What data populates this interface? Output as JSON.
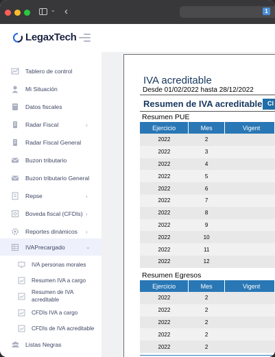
{
  "brand": {
    "name": "LegaxTech"
  },
  "sidebar": {
    "items": [
      {
        "label": "Tablero de control",
        "icon": "chart-icon"
      },
      {
        "label": "Mi Situación",
        "icon": "user-icon"
      },
      {
        "label": "Datos fiscales",
        "icon": "book-icon"
      },
      {
        "label": "Radar Fiscal",
        "icon": "radar-icon",
        "chevron": "›"
      },
      {
        "label": "Radar Fiscal General",
        "icon": "radar-general-icon"
      },
      {
        "label": "Buzon tributario",
        "icon": "mail-icon"
      },
      {
        "label": "Buzon tributario General",
        "icon": "mail-general-icon"
      },
      {
        "label": "Repse",
        "icon": "document-icon",
        "chevron": "›"
      },
      {
        "label": "Boveda fiscal (CFDIs)",
        "icon": "vault-icon",
        "chevron": "›"
      },
      {
        "label": "Reportes dinámicos",
        "icon": "gear-icon",
        "chevron": "›"
      },
      {
        "label": "IVAPrecargado",
        "icon": "table-icon",
        "chevron": "⌄"
      }
    ],
    "sub_items": [
      {
        "label": "IVA personas morales"
      },
      {
        "label": "Resumen IVA a cargo"
      },
      {
        "label": "Resumen de IVA acreditable"
      },
      {
        "label": "CFDIs IVA a cargo"
      },
      {
        "label": "CFDIs de IVA acreditable"
      }
    ],
    "last_item": {
      "label": "Listas Negras",
      "icon": "group-icon"
    }
  },
  "document": {
    "title": "IVA acreditable",
    "date_range": "Desde 01/02/2022 hasta 28/12/2022",
    "heading": "Resumen de IVA acreditable",
    "button_label": "Cl",
    "sections": [
      {
        "label": "Resumen PUE",
        "columns": [
          "Ejercicio",
          "Mes",
          "Vigent"
        ],
        "rows": [
          [
            "2022",
            "2"
          ],
          [
            "2022",
            "3"
          ],
          [
            "2022",
            "4"
          ],
          [
            "2022",
            "5"
          ],
          [
            "2022",
            "6"
          ],
          [
            "2022",
            "7"
          ],
          [
            "2022",
            "8"
          ],
          [
            "2022",
            "9"
          ],
          [
            "2022",
            "10"
          ],
          [
            "2022",
            "11"
          ],
          [
            "2022",
            "12"
          ]
        ]
      },
      {
        "label": "Resumen Egresos",
        "columns": [
          "Ejercicio",
          "Mes",
          "Vigent"
        ],
        "rows": [
          [
            "2022",
            "2"
          ],
          [
            "2022",
            "2"
          ],
          [
            "2022",
            "2"
          ],
          [
            "2022",
            "2"
          ],
          [
            "2022",
            "2"
          ]
        ]
      }
    ]
  },
  "colors": {
    "table_header": "#2977b5",
    "title": "#17375e",
    "accent": "#4a6cf7"
  }
}
